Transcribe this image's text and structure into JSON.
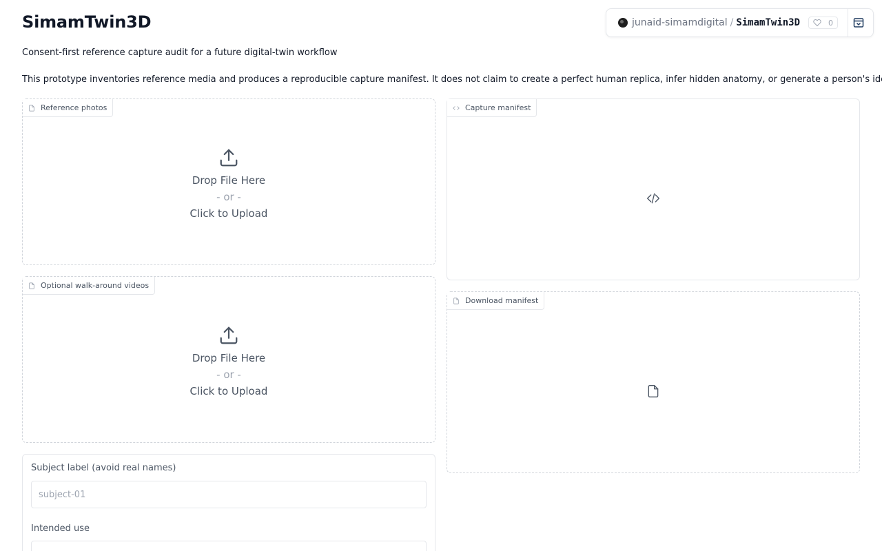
{
  "app": {
    "title": "SimamTwin3D",
    "subtitle": "Consent-first reference capture audit for a future digital-twin workflow",
    "description": "This prototype inventories reference media and produces a reproducible capture manifest. It does not claim to create a perfect human replica, infer hidden anatomy, or generate a person's identity."
  },
  "space_header": {
    "owner": "junaid-simamdigital",
    "separator": "/",
    "repo": "SimamTwin3D",
    "likes": "0"
  },
  "panels": {
    "reference_photos": {
      "label": "Reference photos",
      "drop_text": "Drop File Here",
      "or_text": "- or -",
      "click_text": "Click to Upload"
    },
    "walkaround_videos": {
      "label": "Optional walk-around videos",
      "drop_text": "Drop File Here",
      "or_text": "- or -",
      "click_text": "Click to Upload"
    },
    "capture_manifest": {
      "label": "Capture manifest",
      "icon": "code-icon"
    },
    "download_manifest": {
      "label": "Download manifest",
      "icon": "file-icon"
    }
  },
  "form": {
    "subject_label": "Subject label (avoid real names)",
    "subject_placeholder": "subject-01",
    "intended_use_label": "Intended use",
    "intended_use_value": ""
  }
}
